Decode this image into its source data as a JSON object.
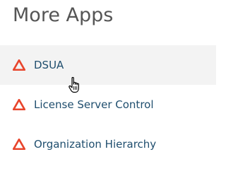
{
  "header": {
    "title": "More Apps"
  },
  "apps": [
    {
      "label": "DSUA",
      "icon": "app-triangle-icon",
      "hovered": true
    },
    {
      "label": "License Server Control",
      "icon": "app-triangle-icon",
      "hovered": false
    },
    {
      "label": "Organization Hierarchy",
      "icon": "app-triangle-icon",
      "hovered": false
    }
  ],
  "colors": {
    "icon": "#e8452c",
    "label": "#1f4e6e",
    "title": "#555555",
    "hover_bg": "#f3f3f3"
  },
  "cursor": {
    "icon": "hand-pointer-icon"
  }
}
